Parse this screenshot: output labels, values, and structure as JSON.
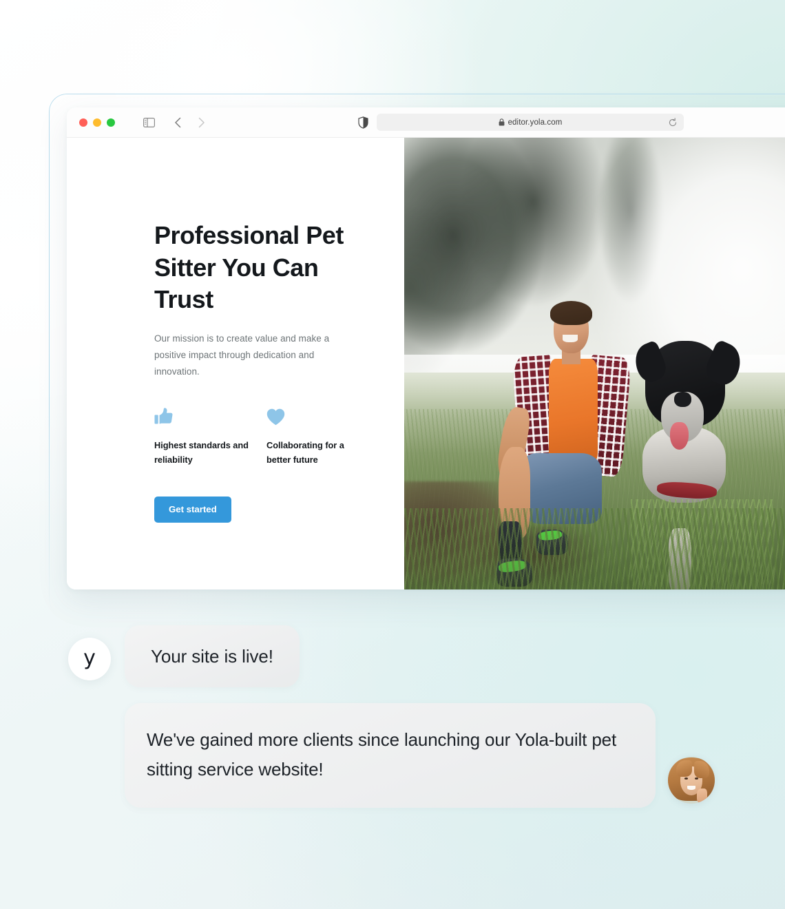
{
  "browser": {
    "window_controls": [
      "close",
      "minimize",
      "maximize"
    ],
    "sidebar_icon": "sidebar-toggle-icon",
    "back_icon": "chevron-left-icon",
    "forward_icon": "chevron-right-icon",
    "shield_icon": "privacy-shield-icon",
    "lock_icon": "lock-icon",
    "reload_icon": "reload-icon",
    "url": "editor.yola.com"
  },
  "site": {
    "hero": {
      "title": "Professional Pet Sitter You Can Trust",
      "subtitle": "Our mission is to create value and make a positive impact through dedication and innovation.",
      "cta_label": "Get started"
    },
    "features": [
      {
        "icon": "thumbs-up-icon",
        "label": "Highest standards and reliability"
      },
      {
        "icon": "heart-icon",
        "label": "Collaborating for a better future"
      }
    ],
    "photo_alt": "Smiling man kneeling in a misty green field beside a black and white border collie"
  },
  "chat": {
    "logo_letter": "y",
    "message_1": "Your site is live!",
    "message_2": "We've gained more clients since launching our Yola-built pet sitting service website!",
    "avatar_alt": "Smiling woman with wavy auburn hair"
  },
  "colors": {
    "accent_blue": "#3498db",
    "feature_icon_blue": "#8ec5e8",
    "page_bg_teal": "#d6eeea",
    "frame_border": "#b9dced",
    "bubble_bg": "#eeeff0",
    "heading_text": "#14181c",
    "body_text": "#6d7477"
  }
}
